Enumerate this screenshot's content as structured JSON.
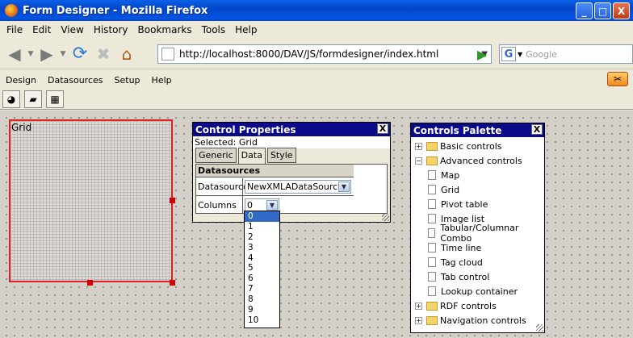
{
  "window": {
    "title": "Form Designer - Mozilla Firefox",
    "buttons": [
      "_",
      "□",
      "X"
    ]
  },
  "browser_menu": [
    "File",
    "Edit",
    "View",
    "History",
    "Bookmarks",
    "Tools",
    "Help"
  ],
  "nav": {
    "url": "http://localhost:8000/DAV/JS/formdesigner/index.html",
    "search_placeholder": "Google",
    "search_engine_glyph": "G"
  },
  "app_menu": [
    "Design",
    "Datasources",
    "Setup",
    "Help"
  ],
  "canvas": {
    "grid_label": "Grid"
  },
  "control_properties": {
    "title": "Control Properties",
    "close": "X",
    "selected": "Selected: Grid",
    "tabs": [
      "Generic",
      "Data",
      "Style"
    ],
    "active_tab": "Data",
    "section": "Datasources",
    "datasource_label": "Datasource",
    "datasource_value": "NewXMLADataSource",
    "columns_label": "Columns",
    "columns_value": "0",
    "column_options": [
      "0",
      "1",
      "2",
      "3",
      "4",
      "5",
      "6",
      "7",
      "8",
      "9",
      "10"
    ],
    "highlighted_option": "0"
  },
  "controls_palette": {
    "title": "Controls Palette",
    "close": "X",
    "groups": [
      {
        "label": "Basic controls",
        "expanded": false,
        "toggle": "+"
      },
      {
        "label": "Advanced controls",
        "expanded": true,
        "toggle": "−"
      },
      {
        "label": "Map"
      },
      {
        "label": "Grid"
      },
      {
        "label": "Pivot table"
      },
      {
        "label": "Image list"
      },
      {
        "label": "Tabular/Columnar Combo"
      },
      {
        "label": "Time line"
      },
      {
        "label": "Tag cloud"
      },
      {
        "label": "Tab control"
      },
      {
        "label": "Lookup container"
      },
      {
        "label": "RDF controls",
        "expanded": false,
        "toggle": "+"
      },
      {
        "label": "Navigation controls",
        "expanded": false,
        "toggle": "+"
      }
    ]
  }
}
